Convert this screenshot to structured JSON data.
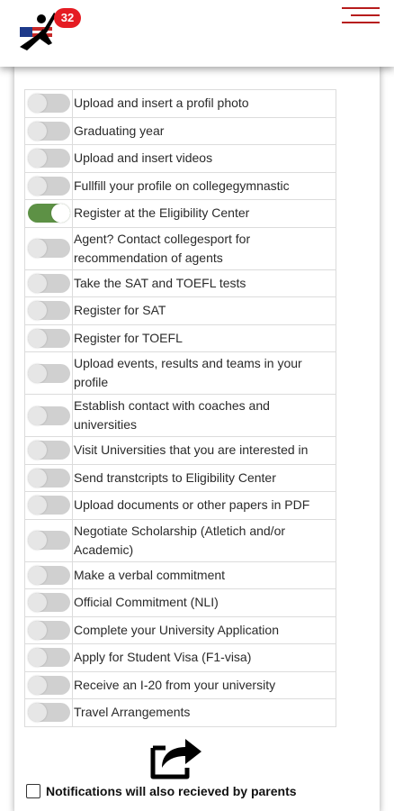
{
  "header": {
    "badge_count": "32",
    "logo_icon": "gymnast-flag-logo-icon",
    "menu_icon": "hamburger-menu-icon",
    "brand_color": "#e51c23"
  },
  "checklist": {
    "on_color": "#5d9145",
    "off_color": "#d0d0d0",
    "items": [
      {
        "label": "Upload and insert a profil photo",
        "checked": false
      },
      {
        "label": "Graduating year",
        "checked": false
      },
      {
        "label": "Upload and insert videos",
        "checked": false
      },
      {
        "label": "Fullfill your profile on collegegymnastic",
        "checked": false
      },
      {
        "label": "Register at the Eligibility Center",
        "checked": true
      },
      {
        "label": "Agent? Contact collegesport for recommendation of agents",
        "checked": false
      },
      {
        "label": "Take the SAT and TOEFL tests",
        "checked": false
      },
      {
        "label": "Register for SAT",
        "checked": false
      },
      {
        "label": "Register for TOEFL",
        "checked": false
      },
      {
        "label": "Upload events, results and teams in your profile",
        "checked": false
      },
      {
        "label": "Establish contact with coaches and universities",
        "checked": false
      },
      {
        "label": "Visit Universities that you are interested in",
        "checked": false
      },
      {
        "label": "Send transtcripts to Eligibility Center",
        "checked": false
      },
      {
        "label": "Upload documents or other papers in PDF",
        "checked": false
      },
      {
        "label": "Negotiate Scholarship (Atletich and/or Academic)",
        "checked": false
      },
      {
        "label": "Make a verbal commitment",
        "checked": false
      },
      {
        "label": "Official Commitment (NLI)",
        "checked": false
      },
      {
        "label": "Complete your University Application",
        "checked": false
      },
      {
        "label": "Apply for Student Visa (F1-visa)",
        "checked": false
      },
      {
        "label": "Receive an I-20 from your university",
        "checked": false
      },
      {
        "label": "Travel Arrangements",
        "checked": false
      }
    ]
  },
  "share": {
    "icon": "share-icon"
  },
  "notify": {
    "label": "Notifications will also recieved by parents",
    "checked": false
  }
}
